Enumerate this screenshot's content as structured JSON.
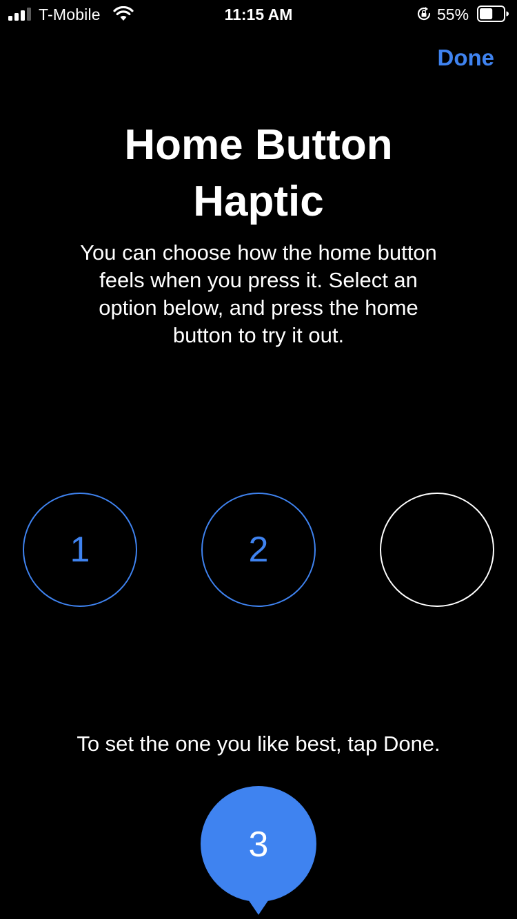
{
  "status_bar": {
    "carrier": "T-Mobile",
    "time": "11:15 AM",
    "battery_percent": "55%",
    "signal_bars_filled": 3,
    "signal_bars_total": 4,
    "battery_level": 0.55,
    "icons": [
      "signal-icon",
      "wifi-icon",
      "rotation-lock-icon",
      "battery-icon"
    ]
  },
  "nav": {
    "done_label": "Done"
  },
  "title": "Home Button\nHaptic",
  "description": "You can choose how the home button\nfeels when you press it. Select an\noption below, and press the home\nbutton to try it out.",
  "options": [
    {
      "label": "1"
    },
    {
      "label": "2"
    },
    {
      "label": "3"
    }
  ],
  "selected_option": "3",
  "hint": "To set the one you like best, tap Done.",
  "colors": {
    "accent": "#3f83f0",
    "background": "#000000",
    "text": "#ffffff"
  }
}
